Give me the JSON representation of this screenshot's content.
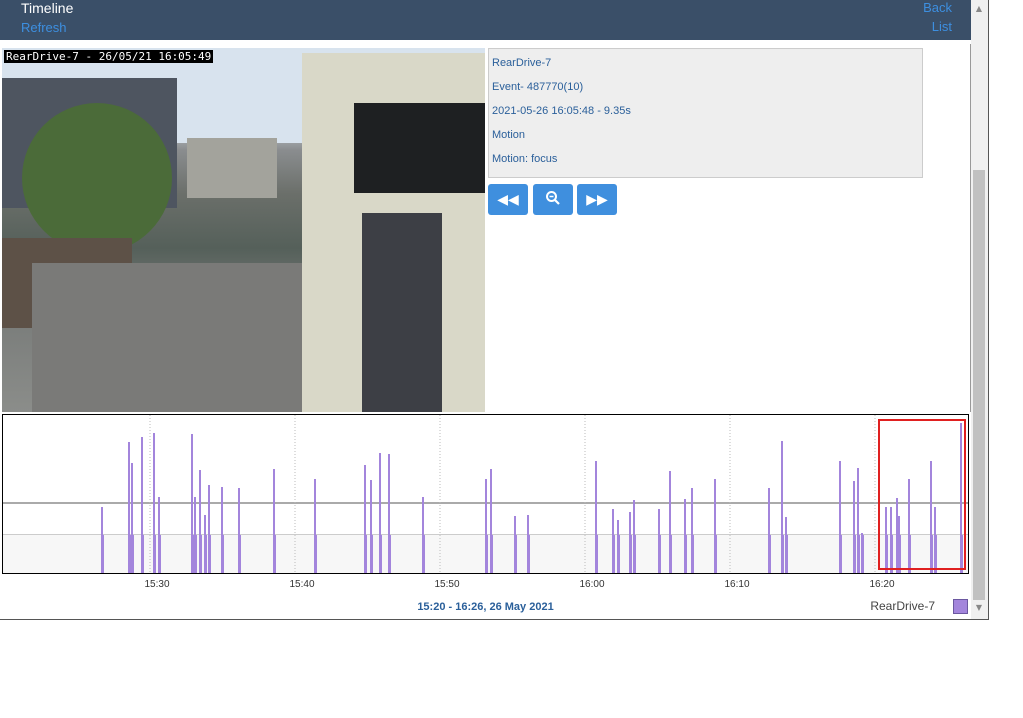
{
  "header": {
    "title": "Timeline",
    "refresh_label": "Refresh",
    "back_label": "Back",
    "list_label": "List"
  },
  "video": {
    "overlay": "RearDrive-7 - 26/05/21 16:05:49"
  },
  "event": {
    "monitor": "RearDrive-7",
    "event_id": "Event- 487770(10)",
    "datetime": "2021-05-26 16:05:48 - 9.35s",
    "cause": "Motion",
    "notes": "Motion: focus"
  },
  "controls": {
    "prev_icon": "rewind-icon",
    "zoom_icon": "zoom-out-icon",
    "next_icon": "fast-forward-icon"
  },
  "timeline": {
    "range_label": "15:20 - 16:26, 26 May 2021",
    "legend_label": "RearDrive-7",
    "tick_labels": [
      "15:30",
      "15:40",
      "15:50",
      "16:00",
      "16:10",
      "16:20"
    ],
    "series_color": "#a385dc"
  },
  "colors": {
    "header_bg": "#3a4f68",
    "link": "#3d8fe0",
    "button": "#3f8fde",
    "highlight": "#e02020"
  }
}
